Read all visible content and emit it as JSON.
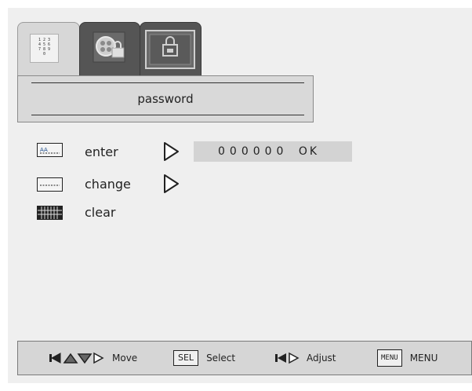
{
  "tabs": [
    {
      "name": "keypad",
      "keypad_digits": "1 2 3\n4 5 6\n7 8 9\n0"
    },
    {
      "name": "media"
    },
    {
      "name": "lock"
    }
  ],
  "title": "password",
  "menu": [
    {
      "label": "enter",
      "icon": "password-enter-icon",
      "has_arrow": true
    },
    {
      "label": "change",
      "icon": "password-change-icon",
      "has_arrow": true
    },
    {
      "label": "clear",
      "icon": "password-clear-icon",
      "has_arrow": false
    }
  ],
  "password_field": {
    "value": "000000",
    "status": "OK"
  },
  "help": {
    "move_label": "Move",
    "select_key": "SEL",
    "select_label": "Select",
    "adjust_label": "Adjust",
    "menu_key": "MENU",
    "menu_label": "MENU"
  },
  "colors": {
    "background": "#efefef",
    "tab_active": "#d7d7d7",
    "tab_inactive": "#555555",
    "panel": "#d9d9d9",
    "field": "#d3d3d3"
  }
}
